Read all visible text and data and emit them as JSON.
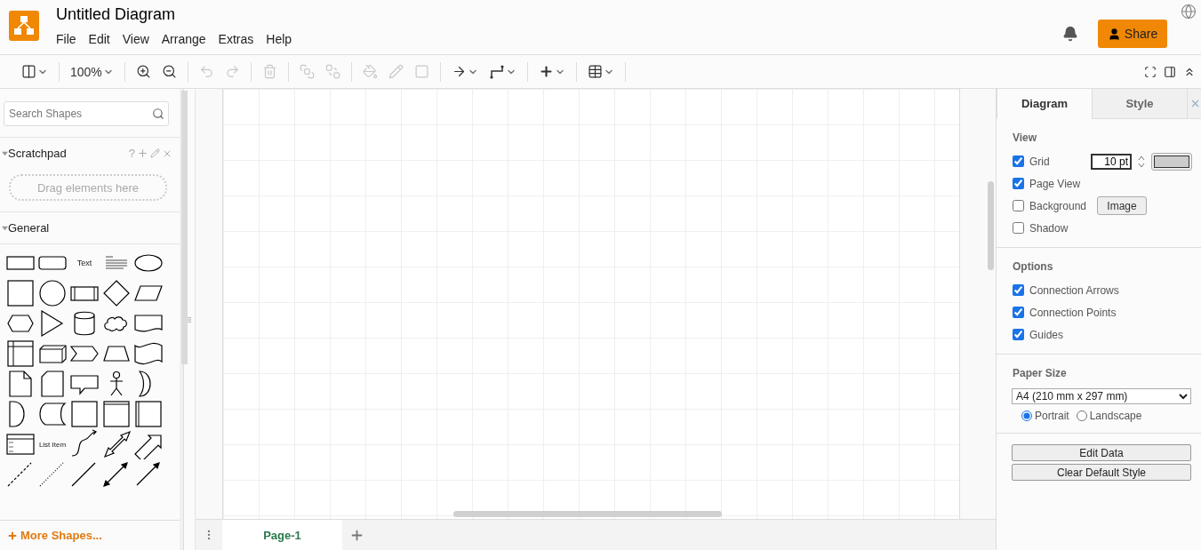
{
  "app": {
    "title": "Untitled Diagram",
    "menu": [
      "File",
      "Edit",
      "View",
      "Arrange",
      "Extras",
      "Help"
    ],
    "share": "Share"
  },
  "toolbar": {
    "groups": [
      [
        {
          "kind": "format-panel",
          "disabled": false,
          "caret": true
        }
      ],
      [
        {
          "kind": "zoom-level",
          "label": "100%",
          "disabled": false,
          "caret": true
        }
      ],
      [
        {
          "kind": "zoom-in",
          "disabled": false,
          "caret": false
        },
        {
          "kind": "zoom-out",
          "disabled": false,
          "caret": false
        }
      ],
      [
        {
          "kind": "undo",
          "disabled": true,
          "caret": false
        },
        {
          "kind": "redo",
          "disabled": true,
          "caret": false
        }
      ],
      [
        {
          "kind": "delete",
          "disabled": true,
          "caret": false
        }
      ],
      [
        {
          "kind": "to-front",
          "disabled": true,
          "caret": false
        },
        {
          "kind": "to-back",
          "disabled": true,
          "caret": false
        }
      ],
      [
        {
          "kind": "fill",
          "disabled": true,
          "caret": false
        },
        {
          "kind": "line",
          "disabled": true,
          "caret": false
        },
        {
          "kind": "shadow",
          "disabled": true,
          "caret": false
        }
      ],
      [
        {
          "kind": "connection",
          "disabled": false,
          "caret": true
        },
        {
          "kind": "waypoints",
          "disabled": false,
          "caret": true
        }
      ],
      [
        {
          "kind": "insert",
          "disabled": false,
          "caret": true
        }
      ],
      [
        {
          "kind": "table",
          "disabled": false,
          "caret": true
        }
      ]
    ]
  },
  "sidebar": {
    "search": {
      "placeholder": "Search Shapes"
    },
    "scratchpad": {
      "title": "Scratchpad",
      "expanded": true,
      "help": "?",
      "drop_hint": "Drag elements here"
    },
    "general": {
      "title": "General",
      "expanded": true,
      "shapes": [
        {
          "kind": "rect"
        },
        {
          "kind": "rounded"
        },
        {
          "kind": "text",
          "label": "Text"
        },
        {
          "kind": "textbox"
        },
        {
          "kind": "ellipse"
        },
        {
          "kind": "square"
        },
        {
          "kind": "circle"
        },
        {
          "kind": "process"
        },
        {
          "kind": "diamond"
        },
        {
          "kind": "parallelogram"
        },
        {
          "kind": "hexagon"
        },
        {
          "kind": "triangle"
        },
        {
          "kind": "cylinder"
        },
        {
          "kind": "cloud"
        },
        {
          "kind": "document"
        },
        {
          "kind": "internal"
        },
        {
          "kind": "cube"
        },
        {
          "kind": "step"
        },
        {
          "kind": "trapezoid"
        },
        {
          "kind": "tape"
        },
        {
          "kind": "note"
        },
        {
          "kind": "card"
        },
        {
          "kind": "callout"
        },
        {
          "kind": "actor"
        },
        {
          "kind": "or"
        },
        {
          "kind": "and"
        },
        {
          "kind": "data"
        },
        {
          "kind": "square"
        },
        {
          "kind": "container"
        },
        {
          "kind": "process2"
        },
        {
          "kind": "list"
        },
        {
          "kind": "list-item",
          "label": "List Item"
        },
        {
          "kind": "curve"
        },
        {
          "kind": "double-arrow-block"
        },
        {
          "kind": "arrow-block"
        },
        {
          "kind": "dashed"
        },
        {
          "kind": "dotted"
        },
        {
          "kind": "line"
        },
        {
          "kind": "bi-arrow"
        },
        {
          "kind": "arrow"
        }
      ]
    },
    "more": "More Shapes..."
  },
  "pages": [
    {
      "label": "Page-1",
      "selected": true
    }
  ],
  "panel": {
    "tabs": [
      {
        "label": "Diagram",
        "selected": true
      },
      {
        "label": "Style",
        "selected": false
      }
    ],
    "view": {
      "title": "View",
      "options": [
        {
          "kind": "grid",
          "label": "Grid",
          "checked": true,
          "size": "10 pt"
        },
        {
          "kind": "plain",
          "label": "Page View",
          "checked": true
        },
        {
          "kind": "image",
          "label": "Background",
          "checked": false,
          "button": "Image"
        },
        {
          "kind": "plain",
          "label": "Shadow",
          "checked": false
        }
      ]
    },
    "options": {
      "title": "Options",
      "options": [
        {
          "label": "Connection Arrows",
          "checked": true
        },
        {
          "label": "Connection Points",
          "checked": true
        },
        {
          "label": "Guides",
          "checked": true
        }
      ]
    },
    "paper": {
      "title": "Paper Size",
      "value": "A4 (210 mm x 297 mm)",
      "orientations": [
        {
          "label": "Portrait",
          "selected": true
        },
        {
          "label": "Landscape",
          "selected": false
        }
      ]
    },
    "buttons": [
      "Edit Data",
      "Clear Default Style"
    ]
  }
}
